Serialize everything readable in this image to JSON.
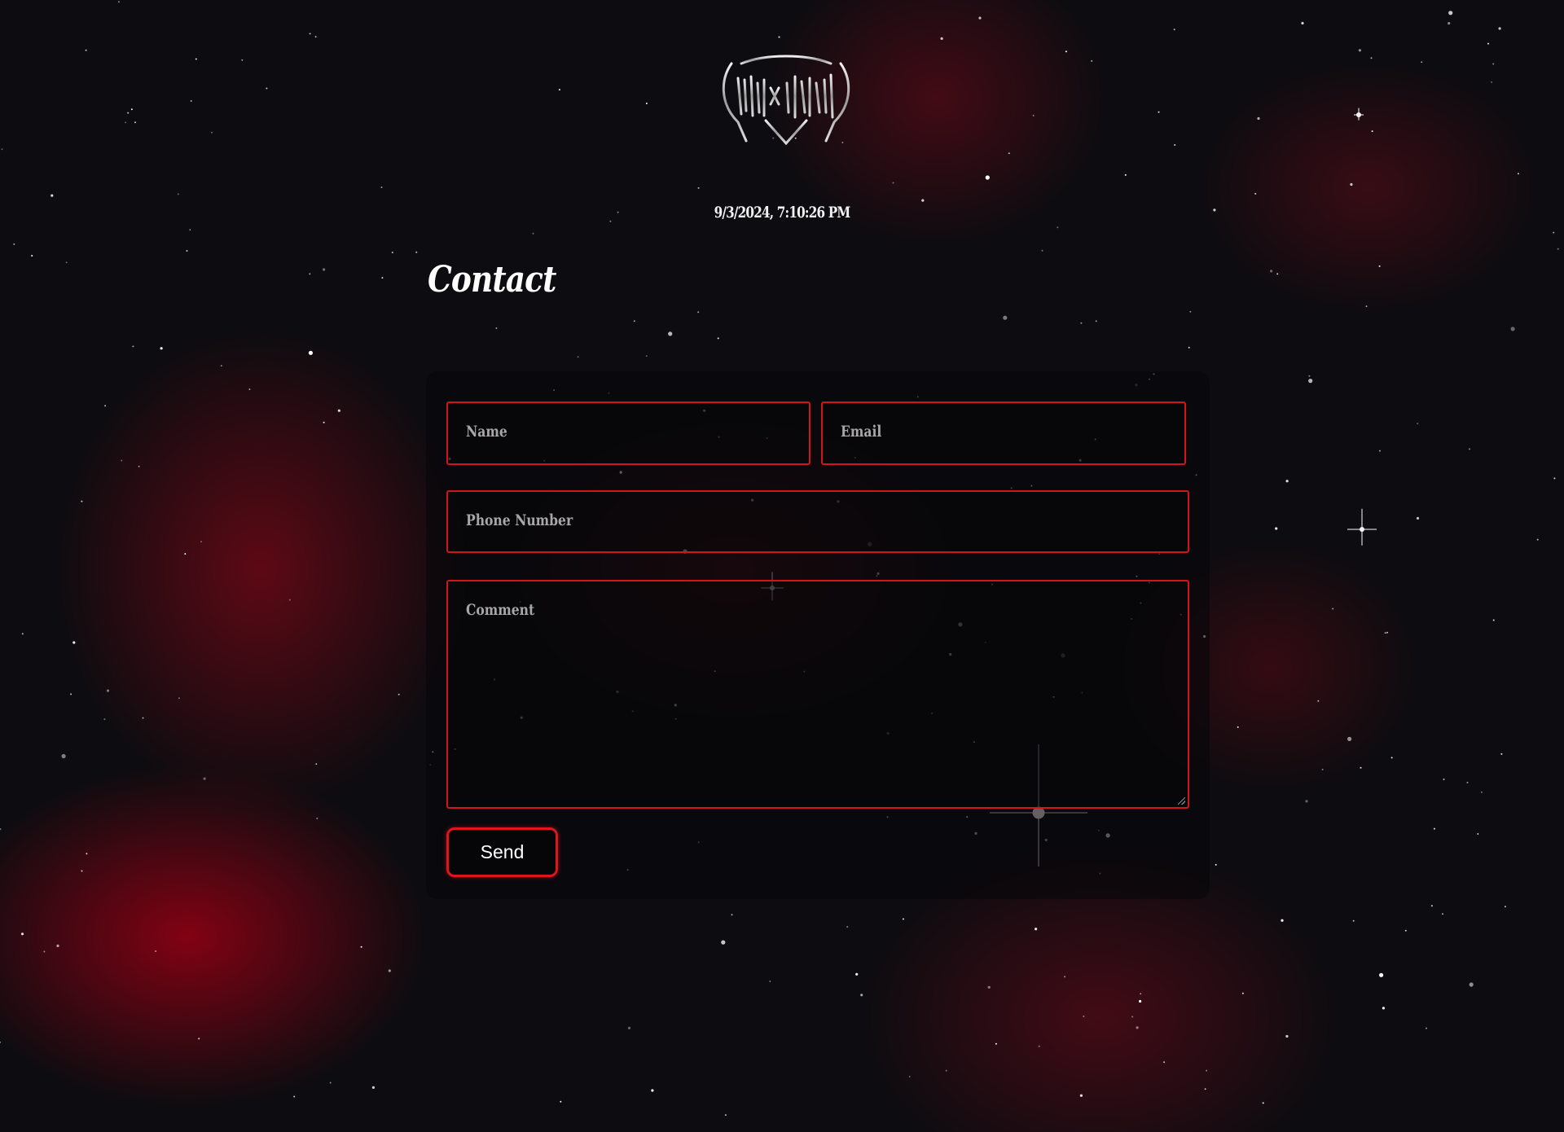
{
  "header": {
    "logo_alt": "Sphinx Wizard logo",
    "timestamp": "9/3/2024, 7:10:26 PM"
  },
  "page": {
    "title": "Contact"
  },
  "form": {
    "name_placeholder": "Name",
    "email_placeholder": "Email",
    "phone_placeholder": "Phone Number",
    "comment_placeholder": "Comment",
    "submit_label": "Send"
  },
  "colors": {
    "accent": "#d2141c",
    "background": "#0d0c10",
    "nebula": "#960014",
    "placeholder": "#a8a6a6"
  }
}
